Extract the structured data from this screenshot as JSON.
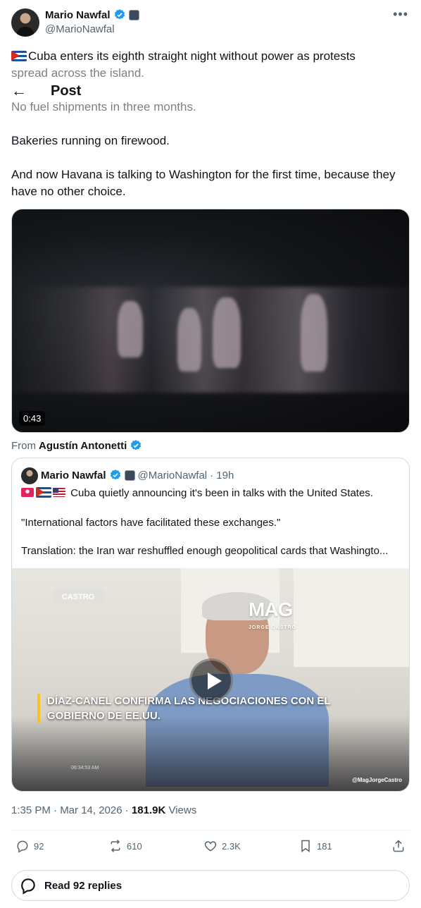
{
  "author": {
    "name": "Mario Nawfal",
    "handle": "@MarioNawfal"
  },
  "nav": {
    "title": "Post"
  },
  "tweet": {
    "line1": "Cuba enters its eighth straight night without power as protests",
    "line1_fade": "spread across the island.",
    "line2": "No fuel shipments in three months.",
    "line3": "Bakeries running on firewood.",
    "line4": "And now Havana is talking to Washington for the first time, because they have no other choice."
  },
  "video": {
    "duration": "0:43"
  },
  "attribution": {
    "prefix": "From",
    "source": "Agustín Antonetti"
  },
  "quoted": {
    "name": "Mario Nawfal",
    "handle": "@MarioNawfal",
    "time": "· 19h",
    "line1": "Cuba quietly announcing it's been in talks with the United States.",
    "line2": "\"International factors have facilitated these exchanges.\"",
    "line3": "Translation: the Iran war reshuffled enough geopolitical cards that Washingto...",
    "video_caption": "DÍAZ-CANEL CONFIRMA LAS NEGOCIACIONES CON EL GOBIERNO DE EE.UU.",
    "video_logo": "MAG",
    "video_logo_sub": "JORGE CASTRO",
    "video_credit": "@MagJorgeCastro",
    "video_timestamp": "06:34:53 AM",
    "video_sign": "CASTRO"
  },
  "meta": {
    "time": "1:35 PM · Mar 14, 2026 ·",
    "views_count": "181.9K",
    "views_label": "Views"
  },
  "actions": {
    "replies": "92",
    "reposts": "610",
    "likes": "2.3K",
    "bookmarks": "181"
  },
  "read_replies": "Read 92 replies",
  "colors": {
    "verified": "#1d9bf0",
    "text": "#0f1419",
    "secondary": "#536471"
  }
}
